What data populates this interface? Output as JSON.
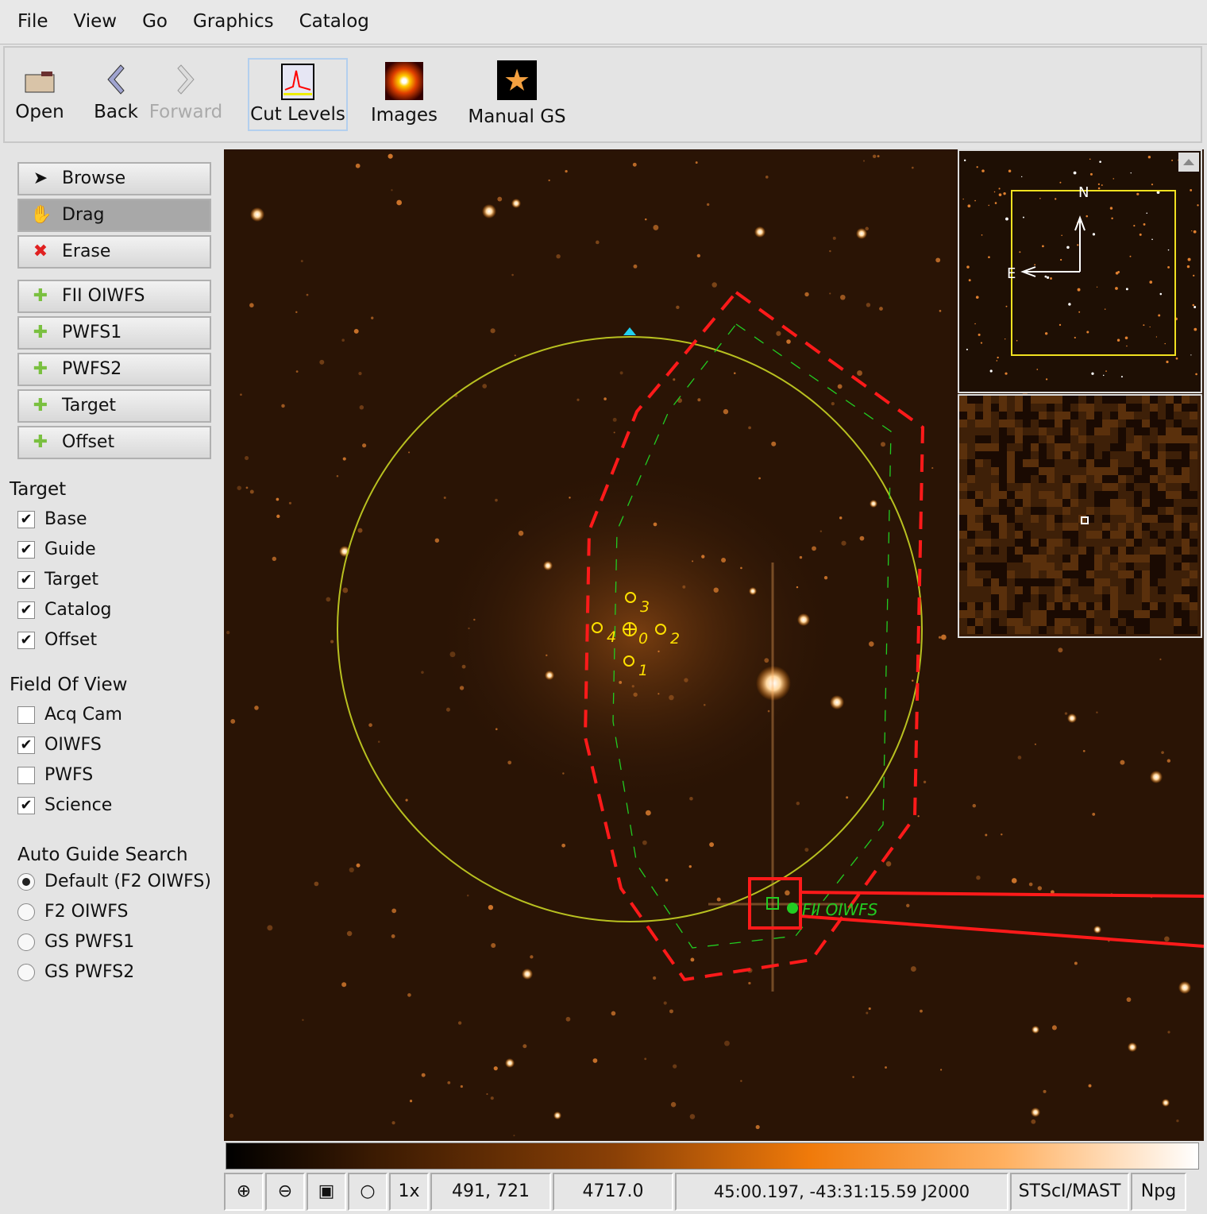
{
  "menu": [
    "File",
    "View",
    "Go",
    "Graphics",
    "Catalog"
  ],
  "toolbar": {
    "open": "Open",
    "back": "Back",
    "forward": "Forward",
    "cut_levels": "Cut Levels",
    "images": "Images",
    "manual_gs": "Manual GS"
  },
  "tools": {
    "browse": "Browse",
    "drag": "Drag",
    "erase": "Erase",
    "fii_oiwfs": "FII OIWFS",
    "pwfs1": "PWFS1",
    "pwfs2": "PWFS2",
    "target": "Target",
    "offset": "Offset"
  },
  "target_section": {
    "title": "Target",
    "items": [
      {
        "label": "Base",
        "checked": true
      },
      {
        "label": "Guide",
        "checked": true
      },
      {
        "label": "Target",
        "checked": true
      },
      {
        "label": "Catalog",
        "checked": true
      },
      {
        "label": "Offset",
        "checked": true
      }
    ]
  },
  "fov_section": {
    "title": "Field Of View",
    "items": [
      {
        "label": "Acq Cam",
        "checked": false
      },
      {
        "label": "OIWFS",
        "checked": true
      },
      {
        "label": "PWFS",
        "checked": false
      },
      {
        "label": "Science",
        "checked": true
      }
    ]
  },
  "auto_guide": {
    "title": "Auto Guide Search",
    "options": [
      {
        "label": "Default (F2 OIWFS)",
        "selected": true
      },
      {
        "label": "F2 OIWFS",
        "selected": false
      },
      {
        "label": "GS PWFS1",
        "selected": false
      },
      {
        "label": "GS PWFS2",
        "selected": false
      }
    ]
  },
  "overlay": {
    "offsets": [
      "0",
      "1",
      "2",
      "3",
      "4"
    ],
    "probe_label": "FII OIWFS",
    "compass_n": "N",
    "compass_e": "E"
  },
  "colors": {
    "science_fov": "#b8c020",
    "patrol": "#ff1a1a",
    "probe": "#22cc22",
    "offset": "#ffe000",
    "base": "#ffe000"
  },
  "status": {
    "zoom": "1x",
    "pixel": "491, 721",
    "value": "4717.0",
    "coords": "45:00.197, -43:31:15.59 J2000",
    "source": "STScI/MAST",
    "type": "Npg"
  }
}
